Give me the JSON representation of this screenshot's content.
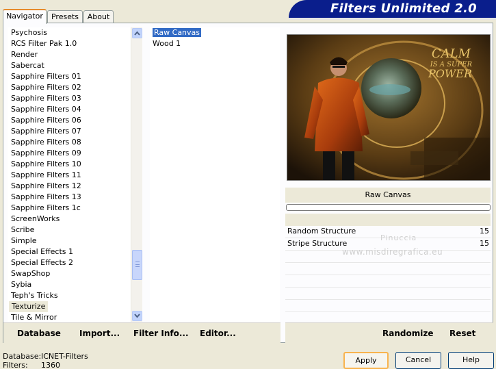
{
  "tabs": [
    {
      "label": "Navigator",
      "active": true
    },
    {
      "label": "Presets",
      "active": false
    },
    {
      "label": "About",
      "active": false
    }
  ],
  "title": "Filters Unlimited 2.0",
  "categories": [
    "Psychosis",
    "RCS Filter Pak 1.0",
    "Render",
    "Sabercat",
    "Sapphire Filters 01",
    "Sapphire Filters 02",
    "Sapphire Filters 03",
    "Sapphire Filters 04",
    "Sapphire Filters 06",
    "Sapphire Filters 07",
    "Sapphire Filters 08",
    "Sapphire Filters 09",
    "Sapphire Filters 10",
    "Sapphire Filters 11",
    "Sapphire Filters 12",
    "Sapphire Filters 13",
    "Sapphire Filters 1c",
    "ScreenWorks",
    "Scribe",
    "Simple",
    "Special Effects 1",
    "Special Effects 2",
    "SwapShop",
    "Sybia",
    "Teph's Tricks",
    "Texturize",
    "Tile & Mirror"
  ],
  "selected_category": "Texturize",
  "filters": [
    "Raw Canvas",
    "Wood 1"
  ],
  "selected_filter": "Raw Canvas",
  "toolbar": {
    "database": "Database",
    "import": "Import...",
    "filter_info": "Filter Info...",
    "editor": "Editor...",
    "randomize": "Randomize",
    "reset": "Reset"
  },
  "preview": {
    "text_line1": "CALM",
    "text_line2": "IS A SUPER",
    "text_line3": "POWER"
  },
  "filter_name": "Raw Canvas",
  "params": [
    {
      "name": "Random Structure",
      "value": "15"
    },
    {
      "name": "Stripe Structure",
      "value": "15"
    }
  ],
  "watermark": {
    "line1": "Pinuccia",
    "line2": "www.misdiregrafica.eu"
  },
  "footer": {
    "database_label": "Database:",
    "database_value": "ICNET-Filters",
    "filters_label": "Filters:",
    "filters_value": "1360"
  },
  "buttons": {
    "apply": "Apply",
    "cancel": "Cancel",
    "help": "Help"
  },
  "icons": {
    "scroll_up": "chevron-up-icon",
    "scroll_down": "chevron-down-icon"
  },
  "colors": {
    "banner": "#0a1e8c",
    "selection": "#316ac5",
    "tab_accent": "#e68b2c"
  }
}
